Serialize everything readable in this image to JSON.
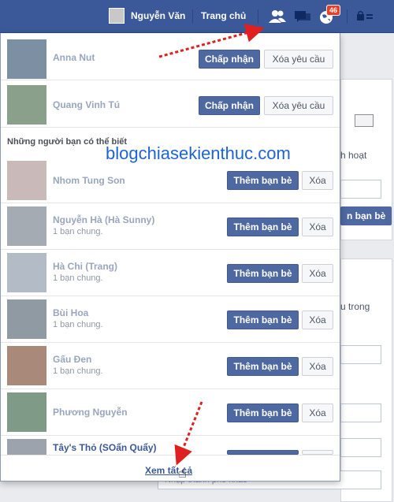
{
  "topbar": {
    "user_name": "Nguyễn Văn",
    "home_label": "Trang chủ",
    "notification_count": "46",
    "friend_requests_icon": "friends-icon",
    "messages_icon": "messages-icon",
    "notifications_icon": "globe-icon",
    "privacy_icon": "lock-icon"
  },
  "requests": [
    {
      "name": "Anna Nut",
      "accept": "Chấp nhận",
      "delete": "Xóa yêu cầu"
    },
    {
      "name": "Quang Vinh Tú",
      "accept": "Chấp nhận",
      "delete": "Xóa yêu cầu"
    }
  ],
  "suggestions_title": "Những người bạn có thể biết",
  "watermark": "blogchiasekienthuc.com",
  "suggestions": [
    {
      "name": "Nhom Tung Son",
      "mutual": "",
      "add": "Thêm bạn bè",
      "remove": "Xóa"
    },
    {
      "name": "Nguyễn Hà (Hà Sunny)",
      "mutual": "1 bạn chung.",
      "add": "Thêm bạn bè",
      "remove": "Xóa"
    },
    {
      "name": "Hà Chi (Trang)",
      "mutual": "1 bạn chung.",
      "add": "Thêm bạn bè",
      "remove": "Xóa"
    },
    {
      "name": "Bùi Hoa",
      "mutual": "1 bạn chung.",
      "add": "Thêm bạn bè",
      "remove": "Xóa"
    },
    {
      "name": "Gấu Đen",
      "mutual": "1 bạn chung.",
      "add": "Thêm bạn bè",
      "remove": "Xóa"
    },
    {
      "name": "Phương Nguyễn",
      "mutual": "",
      "add": "Thêm bạn bè",
      "remove": "Xóa"
    },
    {
      "name": "Tây's Thỏ (SOẩn Quẩy)",
      "mutual": "",
      "add": "",
      "remove": ""
    }
  ],
  "see_all": "Xem tất cả",
  "background": {
    "text_activity": "h hoạt",
    "add_friend_btn": "n bạn bè",
    "text_in": "u trong",
    "city_placeholder": "Nhập thành phố khác"
  },
  "colors": {
    "brand": "#3b5998",
    "button": "#4e69a2",
    "badge": "#f03d25",
    "arrow": "#e02020",
    "watermark": "#1d63d8"
  }
}
